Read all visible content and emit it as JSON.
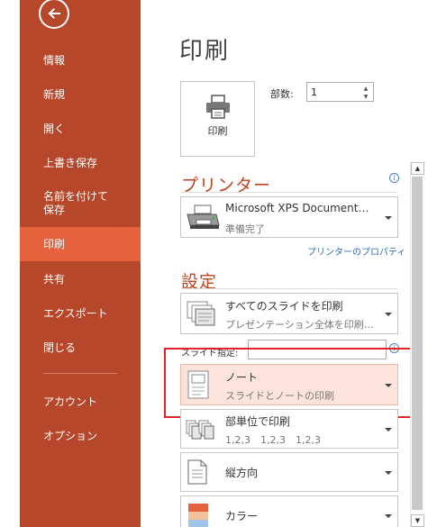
{
  "sidebar": {
    "back_icon": "back-arrow-icon",
    "items": [
      {
        "label": "情報"
      },
      {
        "label": "新規"
      },
      {
        "label": "開く"
      },
      {
        "label": "上書き保存"
      },
      {
        "label": "名前を付けて\n保存"
      },
      {
        "label": "印刷"
      },
      {
        "label": "共有"
      },
      {
        "label": "エクスポート"
      },
      {
        "label": "閉じる"
      },
      {
        "label": "アカウント"
      },
      {
        "label": "オプション"
      }
    ],
    "active_index": 5
  },
  "page_title": "印刷",
  "print_button": {
    "label": "印刷",
    "icon": "printer-icon"
  },
  "copies": {
    "label": "部数:",
    "value": "1"
  },
  "printer_section": {
    "title": "プリンター",
    "printer_name": "Microsoft XPS Document…",
    "printer_status": "準備完了",
    "properties_link": "プリンターのプロパティ"
  },
  "settings_section": {
    "title": "設定",
    "slides_dropdown": {
      "line1": "すべてのスライドを印刷",
      "line2": "プレゼンテーション全体を印刷…"
    },
    "slides_spec_label": "スライド指定:",
    "slides_spec_value": "",
    "layout_dropdown": {
      "line1": "ノート",
      "line2": "スライドとノートの印刷"
    },
    "collate_dropdown": {
      "line1": "部単位で印刷",
      "line2": "1,2,3　1,2,3　1,2,3"
    },
    "orientation_dropdown": {
      "line1": "縦方向"
    },
    "color_dropdown": {
      "line1": "カラー"
    }
  },
  "colors": {
    "sidebar": "#b7472a",
    "sidebar_active": "#e5623d",
    "section_title": "#c1431d",
    "highlight_border": "#e0232d",
    "layout_selected_bg": "#fce4dc"
  }
}
